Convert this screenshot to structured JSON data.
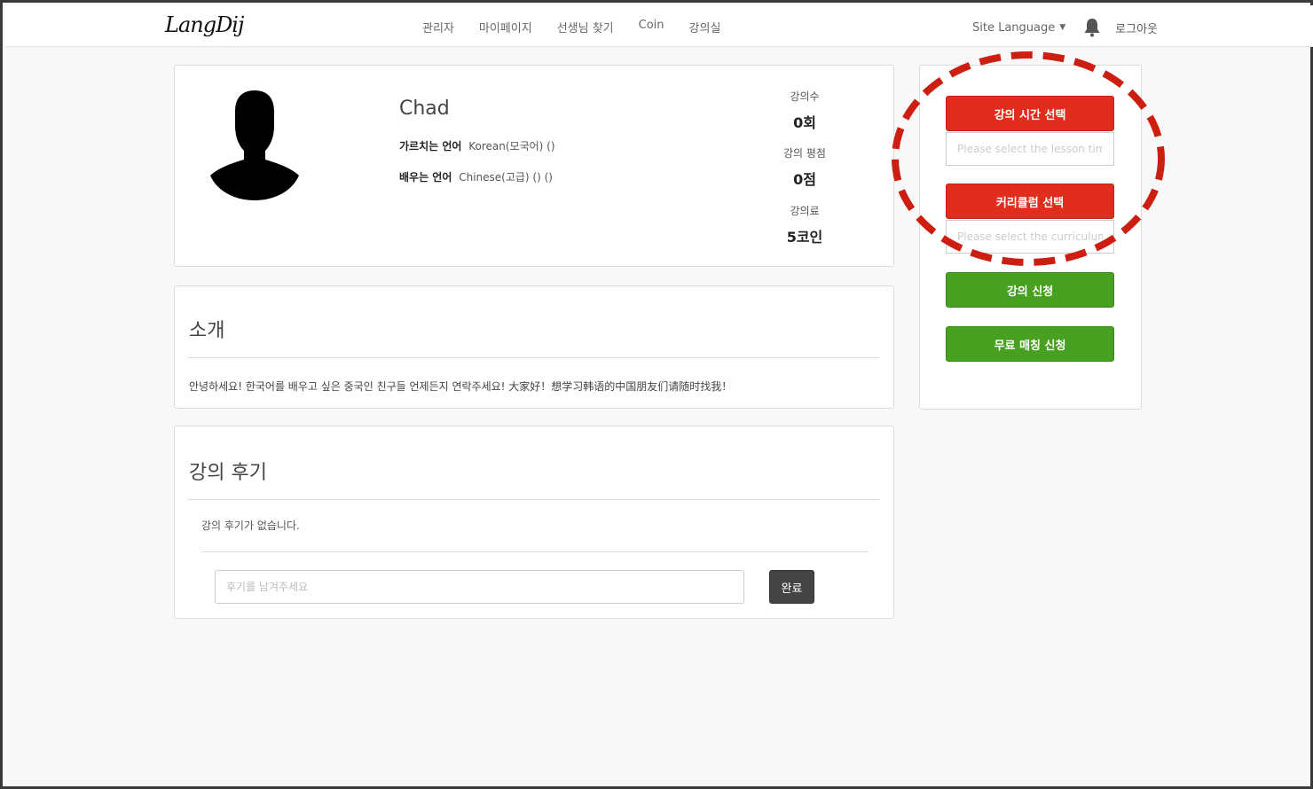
{
  "app": {
    "logo_text": "LangDij"
  },
  "nav": {
    "links": [
      "관리자",
      "마이페이지",
      "선생님 찾기",
      "Coin",
      "강의실"
    ],
    "site_language": "Site Language",
    "logout": "로그아웃",
    "icons": [
      "caret-down-icon",
      "bell-icon"
    ]
  },
  "profile": {
    "name": "Chad",
    "teach_label": "가르치는 언어",
    "teach_value": "Korean(모국어) ()",
    "learn_label": "배우는 언어",
    "learn_value": "Chinese(고급) () ()",
    "stats": [
      {
        "label": "강의수",
        "value": "0회"
      },
      {
        "label": "강의 평점",
        "value": "0점"
      },
      {
        "label": "강의료",
        "value": "5코인"
      }
    ]
  },
  "intro": {
    "title": "소개",
    "text": "안녕하세요! 한국어를 배우고 싶은 중국인 친구들 언제든지 연락주세요! 大家好！想学习韩语的中国朋友们请随时找我！"
  },
  "reviews": {
    "title": "강의 후기",
    "empty_text": "강의 후기가 없습니다.",
    "input_placeholder": "후기를 남겨주세요",
    "submit_label": "완료"
  },
  "sidebar": {
    "select_time_label": "강의 시간 선택",
    "select_time_placeholder": "Please select the lesson time",
    "select_curriculum_label": "커리큘럼 선택",
    "select_curriculum_placeholder": "Please select the curriculum",
    "apply_label": "강의 신청",
    "free_match_label": "무료 매칭 신청"
  },
  "colors": {
    "red_button": "#e12d1d",
    "green_button": "#47a01f",
    "annotation": "#cc1f12",
    "dark_button": "#444444"
  }
}
